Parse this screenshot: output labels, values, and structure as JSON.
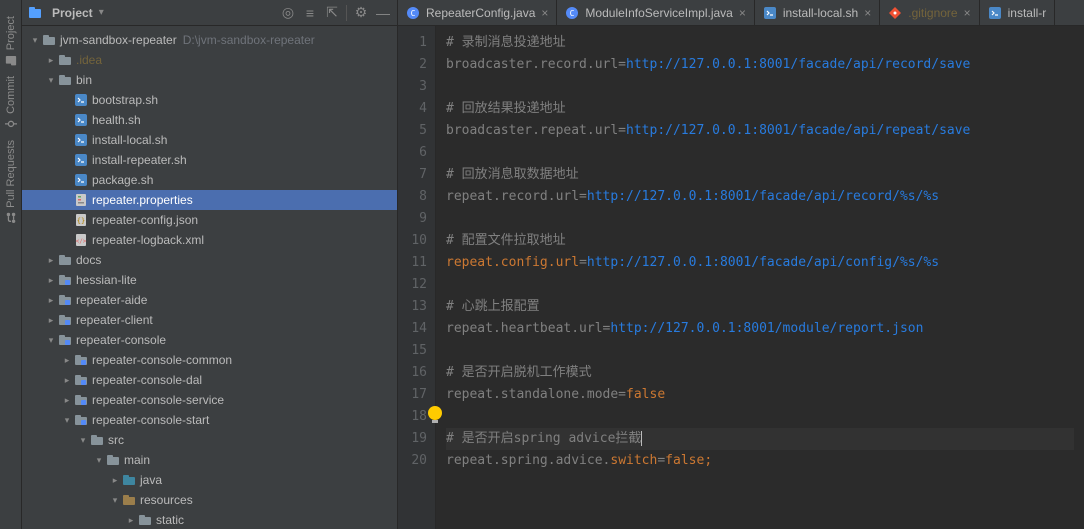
{
  "leftRail": {
    "items": [
      {
        "label": "Project",
        "icon": "project-icon"
      },
      {
        "label": "Commit",
        "icon": "commit-icon"
      },
      {
        "label": "Pull Requests",
        "icon": "pull-requests-icon"
      }
    ]
  },
  "projectHeader": {
    "icon": "project-tool-icon",
    "label": "Project",
    "actions": [
      {
        "name": "target-icon",
        "glyph": "◎"
      },
      {
        "name": "expand-all-icon",
        "glyph": "≡"
      },
      {
        "name": "collapse-all-icon",
        "glyph": "⇱"
      },
      {
        "name": "divider",
        "glyph": ""
      },
      {
        "name": "settings-icon",
        "glyph": "⚙"
      },
      {
        "name": "hide-icon",
        "glyph": "—"
      }
    ]
  },
  "tabs": [
    {
      "icon": "java-icon",
      "label": "RepeaterConfig.java",
      "closable": true
    },
    {
      "icon": "java-icon",
      "label": "ModuleInfoServiceImpl.java",
      "closable": true
    },
    {
      "icon": "shell-icon",
      "label": "install-local.sh",
      "closable": true
    },
    {
      "icon": "gitignore-icon",
      "label": ".gitignore",
      "closable": true
    },
    {
      "icon": "shell-icon",
      "label": "install-r",
      "closable": false,
      "truncated": true
    }
  ],
  "tree": [
    {
      "depth": 0,
      "arrow": "down",
      "icon": "folder-root-icon",
      "label": "jvm-sandbox-repeater",
      "hint": "D:\\jvm-sandbox-repeater"
    },
    {
      "depth": 1,
      "arrow": "right",
      "icon": "folder-dim-icon",
      "label": ".idea",
      "labelColor": "#74643b"
    },
    {
      "depth": 1,
      "arrow": "down",
      "icon": "folder-icon",
      "label": "bin"
    },
    {
      "depth": 2,
      "arrow": "",
      "icon": "shell-icon",
      "label": "bootstrap.sh"
    },
    {
      "depth": 2,
      "arrow": "",
      "icon": "shell-icon",
      "label": "health.sh"
    },
    {
      "depth": 2,
      "arrow": "",
      "icon": "shell-icon",
      "label": "install-local.sh"
    },
    {
      "depth": 2,
      "arrow": "",
      "icon": "shell-icon",
      "label": "install-repeater.sh"
    },
    {
      "depth": 2,
      "arrow": "",
      "icon": "shell-icon",
      "label": "package.sh"
    },
    {
      "depth": 2,
      "arrow": "",
      "icon": "properties-icon",
      "label": "repeater.properties",
      "selected": true
    },
    {
      "depth": 2,
      "arrow": "",
      "icon": "json-icon",
      "label": "repeater-config.json"
    },
    {
      "depth": 2,
      "arrow": "",
      "icon": "xml-icon",
      "label": "repeater-logback.xml"
    },
    {
      "depth": 1,
      "arrow": "right",
      "icon": "folder-icon",
      "label": "docs"
    },
    {
      "depth": 1,
      "arrow": "right",
      "icon": "module-icon",
      "label": "hessian-lite"
    },
    {
      "depth": 1,
      "arrow": "right",
      "icon": "module-icon",
      "label": "repeater-aide"
    },
    {
      "depth": 1,
      "arrow": "right",
      "icon": "module-icon",
      "label": "repeater-client"
    },
    {
      "depth": 1,
      "arrow": "down",
      "icon": "module-icon",
      "label": "repeater-console"
    },
    {
      "depth": 2,
      "arrow": "right",
      "icon": "module-icon",
      "label": "repeater-console-common"
    },
    {
      "depth": 2,
      "arrow": "right",
      "icon": "module-icon",
      "label": "repeater-console-dal"
    },
    {
      "depth": 2,
      "arrow": "right",
      "icon": "module-icon",
      "label": "repeater-console-service"
    },
    {
      "depth": 2,
      "arrow": "down",
      "icon": "module-icon",
      "label": "repeater-console-start"
    },
    {
      "depth": 3,
      "arrow": "down",
      "icon": "folder-icon",
      "label": "src"
    },
    {
      "depth": 4,
      "arrow": "down",
      "icon": "folder-icon",
      "label": "main"
    },
    {
      "depth": 5,
      "arrow": "right",
      "icon": "source-folder-icon",
      "label": "java"
    },
    {
      "depth": 5,
      "arrow": "down",
      "icon": "resource-folder-icon",
      "label": "resources"
    },
    {
      "depth": 6,
      "arrow": "right",
      "icon": "folder-icon",
      "label": "static"
    }
  ],
  "editor": {
    "startLine": 1,
    "bulbLine": 18,
    "caretLine": 19,
    "lines": [
      {
        "tokens": [
          {
            "t": "comment",
            "v": "# 录制消息投递地址"
          }
        ]
      },
      {
        "tokens": [
          {
            "t": "key",
            "v": "broadcaster.record.url="
          },
          {
            "t": "url",
            "v": "http://127.0.0.1:8001/facade/api/record/save"
          }
        ]
      },
      {
        "tokens": []
      },
      {
        "tokens": [
          {
            "t": "comment",
            "v": "# 回放结果投递地址"
          }
        ]
      },
      {
        "tokens": [
          {
            "t": "key",
            "v": "broadcaster.repeat.url="
          },
          {
            "t": "url",
            "v": "http://127.0.0.1:8001/facade/api/repeat/save"
          }
        ]
      },
      {
        "tokens": []
      },
      {
        "tokens": [
          {
            "t": "comment",
            "v": "# 回放消息取数据地址"
          }
        ]
      },
      {
        "tokens": [
          {
            "t": "key",
            "v": "repeat.record.url="
          },
          {
            "t": "url",
            "v": "http://127.0.0.1:8001/facade/api/record/%s/%s"
          }
        ]
      },
      {
        "tokens": []
      },
      {
        "tokens": [
          {
            "t": "comment",
            "v": "# 配置文件拉取地址"
          }
        ]
      },
      {
        "tokens": [
          {
            "t": "key-highlight",
            "v": "repeat.config.url"
          },
          {
            "t": "key",
            "v": "="
          },
          {
            "t": "url",
            "v": "http://127.0.0.1:8001/facade/api/config/%s/%s"
          }
        ]
      },
      {
        "tokens": []
      },
      {
        "tokens": [
          {
            "t": "comment",
            "v": "# 心跳上报配置"
          }
        ]
      },
      {
        "tokens": [
          {
            "t": "key",
            "v": "repeat.heartbeat.url="
          },
          {
            "t": "url",
            "v": "http://127.0.0.1:8001/module/report.json"
          }
        ]
      },
      {
        "tokens": []
      },
      {
        "tokens": [
          {
            "t": "comment",
            "v": "# 是否开启脱机工作模式"
          }
        ]
      },
      {
        "tokens": [
          {
            "t": "key",
            "v": "repeat.standalone.mode="
          },
          {
            "t": "bool",
            "v": "false"
          }
        ]
      },
      {
        "tokens": []
      },
      {
        "tokens": [
          {
            "t": "comment",
            "v": "# 是否开启spring advice拦截"
          }
        ],
        "caret": true,
        "highlight": true
      },
      {
        "tokens": [
          {
            "t": "key",
            "v": "repeat.spring.advice."
          },
          {
            "t": "kw",
            "v": "switch"
          },
          {
            "t": "key",
            "v": "="
          },
          {
            "t": "bool",
            "v": "false"
          },
          {
            "t": "semi",
            "v": ";"
          }
        ]
      }
    ]
  }
}
